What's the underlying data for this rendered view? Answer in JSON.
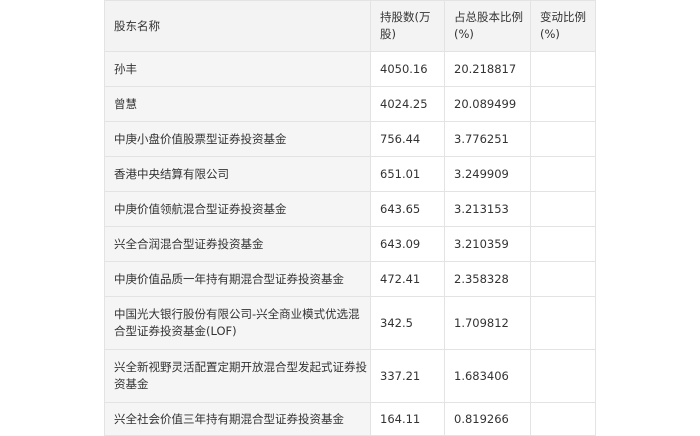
{
  "table": {
    "headers": {
      "name": "股东名称",
      "shares": "持股数(万股)",
      "ratio": "占总股本比例(%)",
      "change": "变动比例(%)"
    },
    "rows": [
      {
        "name": "孙丰",
        "shares": "4050.16",
        "ratio": "20.218817",
        "change": ""
      },
      {
        "name": "曾慧",
        "shares": "4024.25",
        "ratio": "20.089499",
        "change": ""
      },
      {
        "name": "中庚小盘价值股票型证券投资基金",
        "shares": "756.44",
        "ratio": "3.776251",
        "change": ""
      },
      {
        "name": "香港中央结算有限公司",
        "shares": "651.01",
        "ratio": "3.249909",
        "change": ""
      },
      {
        "name": "中庚价值领航混合型证券投资基金",
        "shares": "643.65",
        "ratio": "3.213153",
        "change": ""
      },
      {
        "name": "兴全合润混合型证券投资基金",
        "shares": "643.09",
        "ratio": "3.210359",
        "change": ""
      },
      {
        "name": "中庚价值品质一年持有期混合型证券投资基金",
        "shares": "472.41",
        "ratio": "2.358328",
        "change": ""
      },
      {
        "name": "中国光大银行股份有限公司-兴全商业模式优选混合型证券投资基金(LOF)",
        "shares": "342.5",
        "ratio": "1.709812",
        "change": ""
      },
      {
        "name": "兴全新视野灵活配置定期开放混合型发起式证券投资基金",
        "shares": "337.21",
        "ratio": "1.683406",
        "change": ""
      },
      {
        "name": "兴全社会价值三年持有期混合型证券投资基金",
        "shares": "164.11",
        "ratio": "0.819266",
        "change": ""
      }
    ]
  }
}
